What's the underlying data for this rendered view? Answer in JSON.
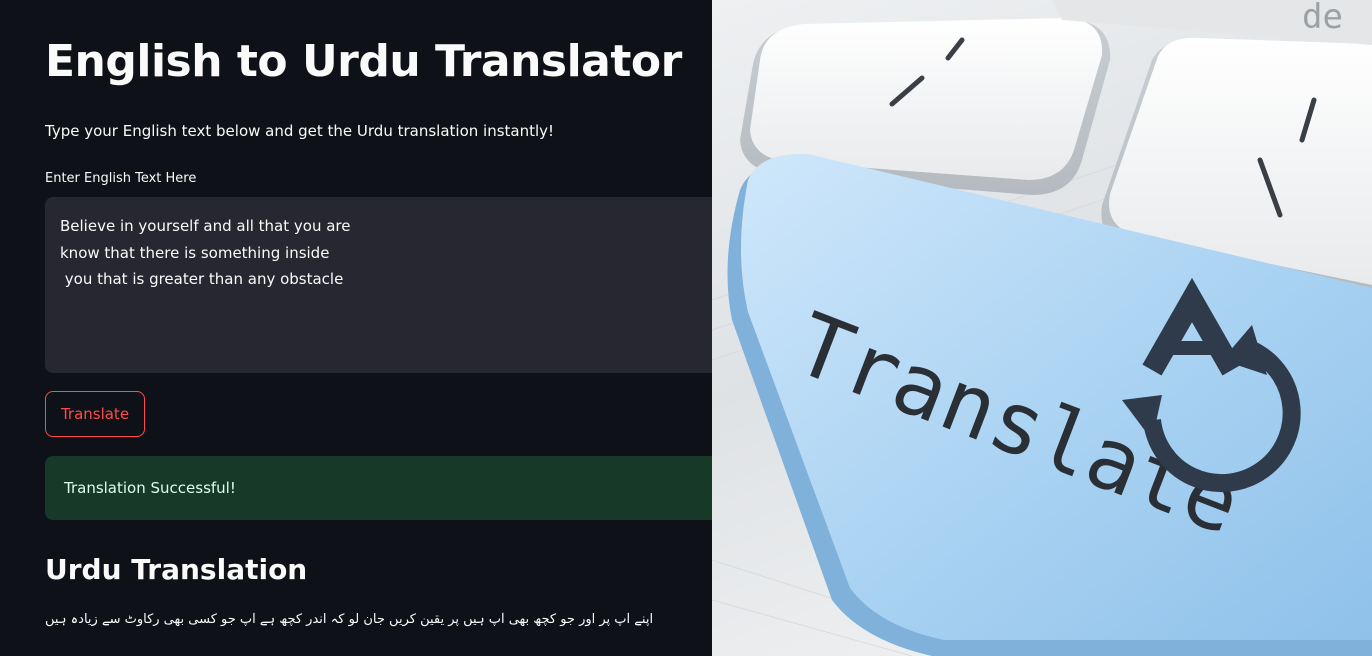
{
  "app": {
    "title": "English to Urdu Translator",
    "subtitle": "Type your English text below and get the Urdu translation instantly!"
  },
  "input": {
    "label": "Enter English Text Here",
    "value": "Believe in yourself and all that you are\nknow that there is something inside\n you that is greater than any obstacle"
  },
  "actions": {
    "translate_label": "Translate"
  },
  "status": {
    "message": "Translation Successful!"
  },
  "output": {
    "heading": "Urdu Translation",
    "text": "اپنے آپ پر اور جو کچھ بھی آپ ہیں پر یقین کریں جان لو کہ اندر کچھ ہے آپ جو کسی بھی رکاوٹ سے زیادہ ہیں"
  },
  "hero": {
    "key_label": "Translate",
    "key_fragment": "de",
    "icon": "translate-icon",
    "colors": {
      "key_blue": "#a9d2f2",
      "icon_dark": "#2f3b4a"
    }
  },
  "theme": {
    "background": "#0e1117",
    "input_bg": "#262730",
    "accent": "#ff4b4b",
    "success_bg": "#173928",
    "success_text": "#dffde9"
  }
}
